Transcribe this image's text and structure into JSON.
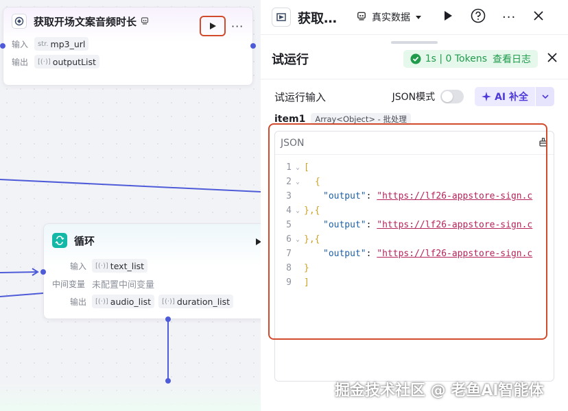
{
  "canvas": {
    "node_plugin": {
      "title": "获取开场文案音频时长",
      "badge_icon": "plugin-badge-icon",
      "inputs_label": "输入",
      "outputs_label": "输出",
      "input_param": {
        "prefix": "str.",
        "name": "mp3_url"
      },
      "output_param": {
        "prefix": "[(·)]",
        "name": "outputList"
      }
    },
    "node_loop": {
      "title": "循环",
      "inputs_label": "输入",
      "intermediate_label": "中间变量",
      "intermediate_value": "未配置中间变量",
      "outputs_label": "输出",
      "input_param": {
        "prefix": "[(·)]",
        "name": "text_list"
      },
      "output_params": [
        {
          "prefix": "[(·)]",
          "name": "audio_list"
        },
        {
          "prefix": "[(·)]",
          "name": "duration_list"
        }
      ]
    },
    "edge_color": "#4e5bd8"
  },
  "header": {
    "title": "获取…",
    "data_mode": "真实数据"
  },
  "panel": {
    "title": "试运行",
    "stats": "1s | 0 Tokens",
    "log_link": "查看日志",
    "input_title": "试运行输入",
    "json_mode_label": "JSON模式",
    "json_mode_on": false,
    "ai_button": "AI 补全",
    "item_name": "item1",
    "item_type": "Array<Object> - 批处理",
    "editor_label": "JSON",
    "code_lines": [
      {
        "n": "1",
        "fold": "﹀",
        "text": "["
      },
      {
        "n": "2",
        "fold": "﹀",
        "text": "{"
      },
      {
        "n": "3",
        "fold": "",
        "key": "\"output\"",
        "value": "\"https://lf26-appstore-sign.c"
      },
      {
        "n": "4",
        "fold": "﹀",
        "text": "},{"
      },
      {
        "n": "5",
        "fold": "",
        "key": "\"output\"",
        "value": "\"https://lf26-appstore-sign.c"
      },
      {
        "n": "6",
        "fold": "﹀",
        "text": "},{"
      },
      {
        "n": "7",
        "fold": "",
        "key": "\"output\"",
        "value": "\"https://lf26-appstore-sign.c"
      },
      {
        "n": "8",
        "fold": "",
        "text": "}"
      },
      {
        "n": "9",
        "fold": "",
        "text": "]"
      }
    ]
  },
  "colors": {
    "accent_purple": "#4d3ad8",
    "success_green": "#1f9b4b",
    "highlight_red": "#d14a2b"
  },
  "watermark": "掘金技术社区 @ 老鱼AI智能体"
}
